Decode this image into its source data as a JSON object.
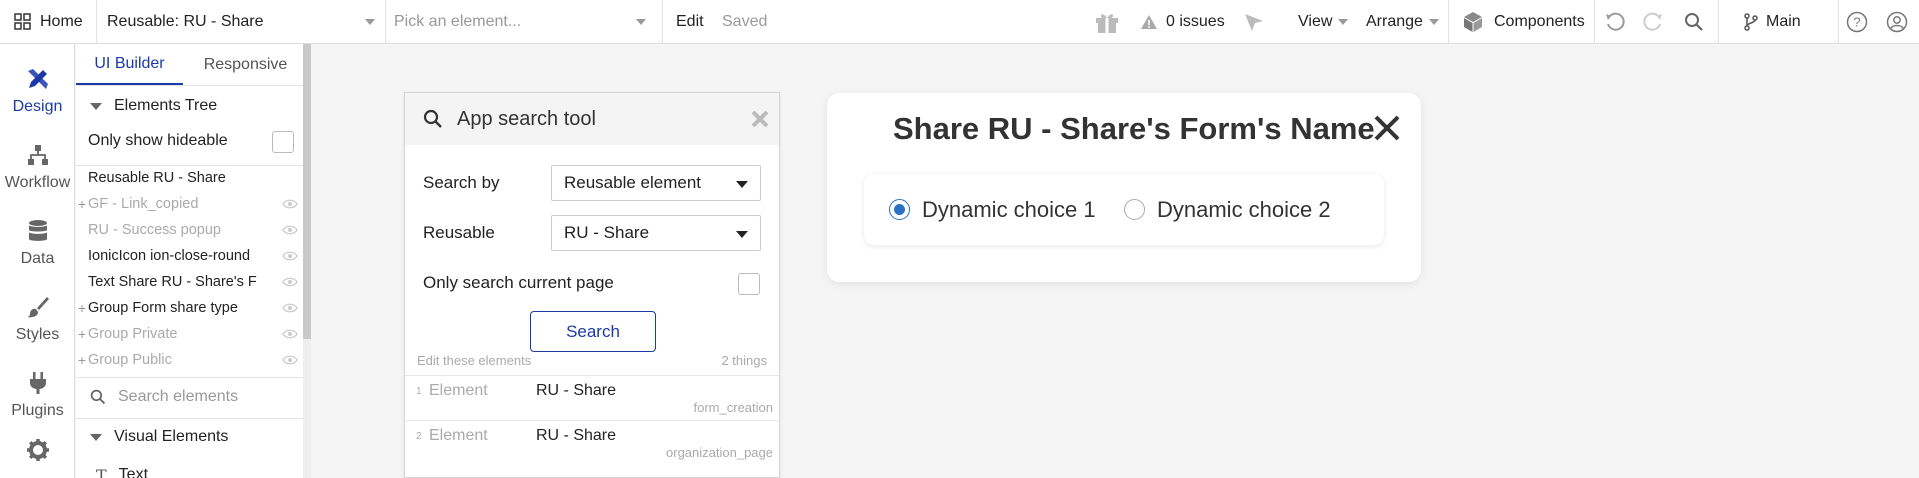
{
  "topbar": {
    "home_label": "Home",
    "page_select": "Reusable: RU - Share",
    "element_picker_placeholder": "Pick an element...",
    "edit_label": "Edit",
    "saved_label": "Saved",
    "issues_label": "0 issues",
    "view_label": "View",
    "arrange_label": "Arrange",
    "components_label": "Components",
    "branch_label": "Main"
  },
  "rail": {
    "items": [
      {
        "label": "Design",
        "icon": "design-icon"
      },
      {
        "label": "Workflow",
        "icon": "workflow-icon"
      },
      {
        "label": "Data",
        "icon": "database-icon"
      },
      {
        "label": "Styles",
        "icon": "brush-icon"
      },
      {
        "label": "Plugins",
        "icon": "plug-icon"
      },
      {
        "label": "",
        "icon": "gear-icon"
      }
    ]
  },
  "panel": {
    "tabs": [
      "UI Builder",
      "Responsive"
    ],
    "tree_header": "Elements Tree",
    "only_hideable_label": "Only show hideable",
    "tree": [
      {
        "label": "Reusable RU - Share",
        "plus": false,
        "dim": false,
        "eye": false
      },
      {
        "label": "GF - Link_copied",
        "plus": true,
        "dim": true,
        "eye": true
      },
      {
        "label": "RU - Success popup",
        "plus": false,
        "dim": true,
        "eye": true
      },
      {
        "label": "IonicIcon ion-close-round",
        "plus": false,
        "dim": false,
        "eye": true
      },
      {
        "label": "Text Share RU - Share's F",
        "plus": false,
        "dim": false,
        "eye": true
      },
      {
        "label": "Group Form share type",
        "plus": true,
        "dim": false,
        "eye": true
      },
      {
        "label": "Group Private",
        "plus": true,
        "dim": true,
        "eye": true
      },
      {
        "label": "Group Public",
        "plus": true,
        "dim": true,
        "eye": true
      }
    ],
    "search_placeholder": "Search elements",
    "visual_elements_header": "Visual Elements",
    "partial_item": "Text"
  },
  "search_tool": {
    "title": "App search tool",
    "search_by_label": "Search by",
    "search_by_value": "Reusable element",
    "reusable_label": "Reusable",
    "reusable_value": "RU - Share",
    "current_page_label": "Only search current page",
    "search_button": "Search",
    "results_header": "Edit these elements",
    "results_count": "2 things",
    "results": [
      {
        "num": "1",
        "kind": "Element",
        "name": "RU - Share",
        "page": "form_creation"
      },
      {
        "num": "2",
        "kind": "Element",
        "name": "RU - Share",
        "page": "organization_page"
      }
    ]
  },
  "card": {
    "title": "Share RU - Share's Form's Name",
    "choices": [
      {
        "label": "Dynamic choice 1",
        "selected": true
      },
      {
        "label": "Dynamic choice 2",
        "selected": false
      }
    ]
  },
  "colors": {
    "accent": "#1b3aa8",
    "radio": "#2a72c4",
    "muted": "#999999"
  }
}
